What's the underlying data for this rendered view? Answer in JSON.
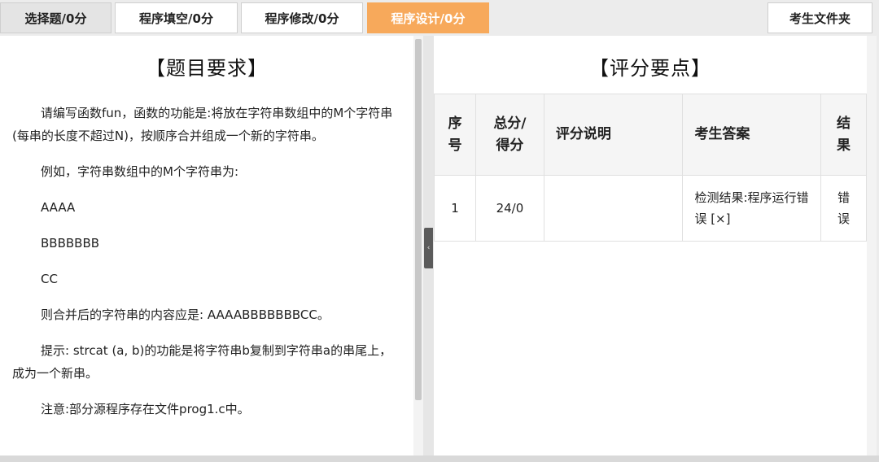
{
  "tabs": [
    {
      "label": "选择题/0分"
    },
    {
      "label": "程序填空/0分"
    },
    {
      "label": "程序修改/0分"
    },
    {
      "label": "程序设计/0分"
    }
  ],
  "folder_button": "考生文件夹",
  "requirements": {
    "title": "【题目要求】",
    "paragraphs": [
      "请编写函数fun，函数的功能是:将放在字符串数组中的M个字符串(每串的长度不超过N)，按顺序合并组成一个新的字符串。",
      "例如，字符串数组中的M个字符串为:",
      "AAAA",
      "BBBBBBB",
      "CC",
      "则合并后的字符串的内容应是: AAAABBBBBBBCC。",
      "提示: strcat (a, b)的功能是将字符串b复制到字符串a的串尾上，成为一个新串。",
      "注意:部分源程序存在文件prog1.c中。"
    ]
  },
  "splitter_glyph": "‹",
  "grading": {
    "title": "【评分要点】",
    "headers": {
      "index_line1": "序",
      "index_line2": "号",
      "score_line1": "总分/",
      "score_line2": "得分",
      "desc": "评分说明",
      "answer": "考生答案",
      "result_line1": "结",
      "result_line2": "果"
    },
    "rows": [
      {
        "index": "1",
        "score": "24/0",
        "desc": "",
        "answer": "检测结果:程序运行错误 [×]",
        "result_line1": "错",
        "result_line2": "误"
      }
    ]
  },
  "colors": {
    "active_tab": "#f7a95b",
    "background": "#ececec"
  }
}
